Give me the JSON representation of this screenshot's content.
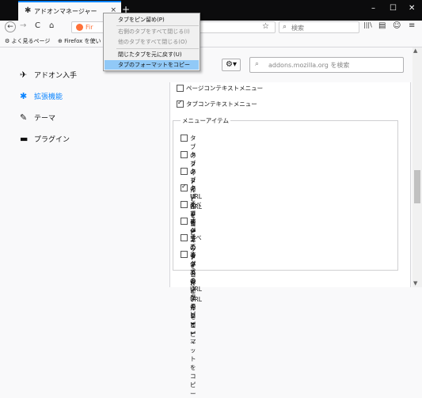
{
  "tab": {
    "title": "アドオンマネージャー",
    "close": "×",
    "new": "+"
  },
  "window": {
    "minimize": "–",
    "maximize": "☐",
    "close": "✕"
  },
  "nav": {
    "back": "←",
    "forward": "→",
    "reload": "C",
    "home": "⌂",
    "url_fragment": "Fir",
    "url_placeholder": "",
    "star": "☆",
    "search_placeholder": "検索",
    "library": "|||\\",
    "sidebar": "▤",
    "account": "☺",
    "menu": "≡"
  },
  "bookmarks": [
    {
      "label": "よく見るページ",
      "icon": "gear-icon"
    },
    {
      "label": "Firefox を使い",
      "icon": "globe-icon"
    }
  ],
  "context_menu": [
    {
      "label": "タブをピン留め(P)",
      "disabled": false,
      "highlight": false
    },
    {
      "label": "右側のタブをすべて閉じる(I)",
      "disabled": true,
      "highlight": false
    },
    {
      "label": "他のタブをすべて閉じる(O)",
      "disabled": true,
      "highlight": false
    },
    {
      "label": "閉じたタブを元に戻す(U)",
      "disabled": false,
      "highlight": false
    },
    {
      "label": "タブのフォーマットをコピー",
      "disabled": false,
      "highlight": true
    }
  ],
  "categories": [
    {
      "label": "アドオン入手",
      "icon": "extensions-discover-icon",
      "selected": false
    },
    {
      "label": "拡張機能",
      "icon": "puzzle-icon",
      "selected": true
    },
    {
      "label": "テーマ",
      "icon": "brush-icon",
      "selected": false
    },
    {
      "label": "プラグイン",
      "icon": "plugin-icon",
      "selected": false
    }
  ],
  "toolbar": {
    "gear": "⚙▾",
    "amo_search_placeholder": "addons.mozilla.org を検索"
  },
  "prefs": {
    "context_items": [
      {
        "label": "ページコンテキストメニュー",
        "checked": false
      },
      {
        "label": "タブコンテキストメニュー",
        "checked": true
      }
    ],
    "menu_items_legend": "メニューアイテム",
    "menu_items": [
      {
        "label": "タブのタイトルとURLをコピー",
        "checked": false
      },
      {
        "label": "タブのタイトルをコピー",
        "checked": false
      },
      {
        "label": "タブのURLをコピー",
        "checked": false
      },
      {
        "label": "タブのフォーマットをコピー",
        "checked": true
      },
      {
        "label": "すべてのタブのタイトルとURLをコピー",
        "checked": false
      },
      {
        "label": "すべてのタブのタイトルをコピー",
        "checked": false
      },
      {
        "label": "すべてのタブのURLをコピー",
        "checked": false
      },
      {
        "label": "すべてのタブのフォーマットをコピー",
        "checked": false
      }
    ]
  },
  "colors": {
    "accent": "#0a84ff",
    "titlebar": "#0c0c0d",
    "menu_highlight": "#91c9f7"
  }
}
